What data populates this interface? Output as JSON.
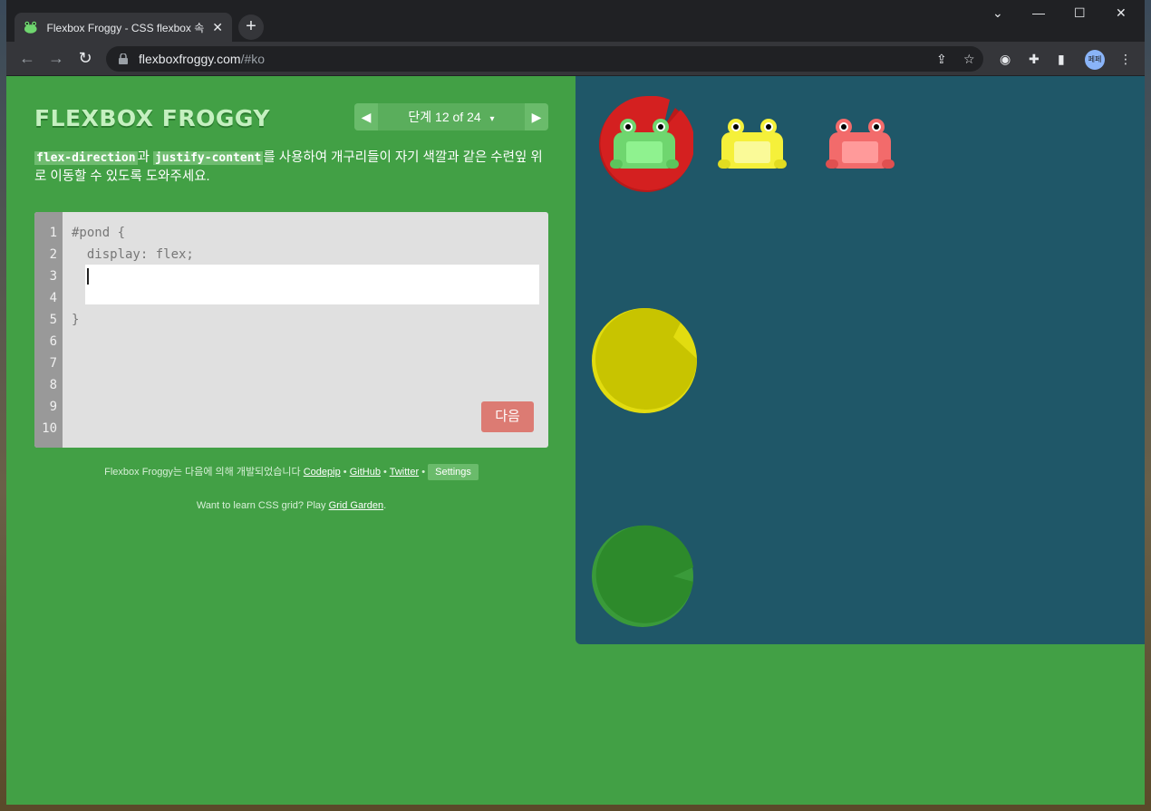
{
  "browser": {
    "tab_title": "Flexbox Froggy - CSS flexbox 속",
    "tab_close": "✕",
    "new_tab": "+",
    "url_host": "flexboxfroggy.com",
    "url_path": "/#ko",
    "profile_label": "페페",
    "window_controls": {
      "dropdown": "⌄",
      "minimize": "—",
      "maximize": "☐",
      "close": "✕"
    }
  },
  "header": {
    "logo": "FLEXBOX FROGGY",
    "level_label": "단계 12 of 24",
    "level_dropdown": "▾",
    "prev_arrow": "◀",
    "next_arrow": "▶"
  },
  "instructions": {
    "prop1": "flex-direction",
    "joiner": "과",
    "prop2": "justify-content",
    "rest": "를 사용하여 개구리들이 자기 색깔과 같은 수련잎 위로 이동할 수 있도록 도와주세요."
  },
  "editor": {
    "line_numbers": [
      "1",
      "2",
      "3",
      "4",
      "5",
      "6",
      "7",
      "8",
      "9",
      "10"
    ],
    "line1": "#pond {",
    "line2": "  display: flex;",
    "line5": "}",
    "input_value": "",
    "next_button": "다음"
  },
  "footer": {
    "credits_prefix": "Flexbox Froggy는 다음에 의해 개발되었습니다",
    "codepip": "Codepip",
    "github": "GitHub",
    "twitter": "Twitter",
    "bullet": "•",
    "settings": "Settings",
    "grid_prefix": "Want to learn CSS grid? Play",
    "grid_link": "Grid Garden",
    "grid_suffix": "."
  },
  "pond": {
    "background": "#1f5768",
    "frogs": [
      {
        "color": "green",
        "hex": "#6fd66f"
      },
      {
        "color": "yellow",
        "hex": "#f5f03a"
      },
      {
        "color": "red",
        "hex": "#f26b6b"
      }
    ],
    "lilypads": [
      {
        "color": "red",
        "hex": "#d42020"
      },
      {
        "color": "yellow",
        "hex": "#c8c400"
      },
      {
        "color": "green",
        "hex": "#2d8a2b"
      }
    ]
  }
}
